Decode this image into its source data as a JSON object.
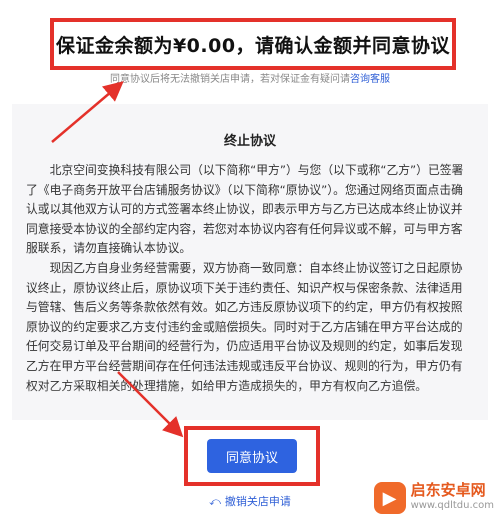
{
  "header": {
    "title": "保证金余额为¥0.00，请确认金额并同意协议",
    "hint_text": "同意协议后将无法撤销关店申请，若对保证金有疑问请",
    "hint_link": "咨询客服"
  },
  "agreement": {
    "title": "终止协议",
    "paragraphs": [
      "北京空间变换科技有限公司（以下简称“甲方”）与您（以下或称“乙方”）已签署了《电子商务开放平台店铺服务协议》（以下简称“原协议”）。您通过网络页面点击确认或以其他双方认可的方式签署本终止协议，即表示甲方与乙方已达成本终止协议并同意接受本协议的全部约定内容，若您对本协议内容有任何异议或不解，可与甲方客服联系，请勿直接确认本协议。",
      "现因乙方自身业务经营需要，双方协商一致同意：自本终止协议签订之日起原协议终止，原协议终止后，原协议项下关于违约责任、知识产权与保密条款、法律适用与管辖、售后义务等条款依然有效。如乙方违反原协议项下的约定，甲方仍有权按照原协议的约定要求乙方支付违约金或赔偿损失。同时对于乙方店铺在甲方平台达成的任何交易订单及平台期间的经营行为，仍应适用平台协议及规则的约定，如事后发现乙方在甲方平台经营期间存在任何违法违规或违反平台协议、规则的行为，甲方仍有权对乙方采取相关的处理措施，如给甲方造成损失的，甲方有权向乙方追偿。"
    ]
  },
  "actions": {
    "agree_label": "同意协议",
    "cancel_label": "撤销关店申请"
  },
  "watermark": {
    "title": "启东安卓网",
    "url": "www.qdltdu.com"
  },
  "colors": {
    "accent": "#2e63e0",
    "annotation_red": "#e4312a"
  }
}
